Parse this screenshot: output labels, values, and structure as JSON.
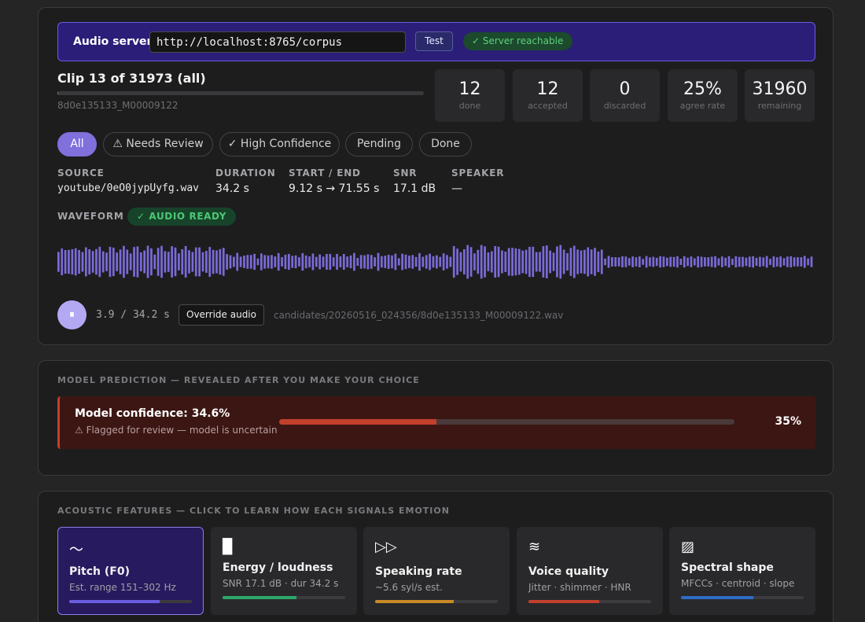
{
  "server": {
    "label": "Audio server:",
    "url": "http://localhost:8765/corpus",
    "test_label": "Test",
    "status": "✓ Server reachable"
  },
  "clip": {
    "title": "Clip 13 of 31973 (all)",
    "progress_fraction": 0.0004,
    "id": "8d0e135133_M00009122"
  },
  "stats": [
    {
      "value": "12",
      "label": "done"
    },
    {
      "value": "12",
      "label": "accepted"
    },
    {
      "value": "0",
      "label": "discarded"
    },
    {
      "value": "25%",
      "label": "agree rate"
    },
    {
      "value": "31960",
      "label": "remaining"
    }
  ],
  "filters": [
    {
      "label": "All",
      "active": true
    },
    {
      "label": "⚠ Needs Review",
      "active": false
    },
    {
      "label": "✓ High Confidence",
      "active": false
    },
    {
      "label": "Pending",
      "active": false
    },
    {
      "label": "Done",
      "active": false
    }
  ],
  "meta": {
    "source_h": "SOURCE",
    "source_v": "youtube/0eO0jypUyfg.wav",
    "duration_h": "DURATION",
    "duration_v": "34.2 s",
    "startend_h": "START / END",
    "startend_v": "9.12 s → 71.55 s",
    "snr_h": "SNR",
    "snr_v": "17.1 dB",
    "speaker_h": "SPEAKER",
    "speaker_v": "—"
  },
  "waveform": {
    "label": "WAVEFORM",
    "status": "✓ AUDIO READY",
    "color": "#7b6bd8"
  },
  "player": {
    "play_icon": "pause-icon",
    "play_glyph": "⏸",
    "time": "3.9 / 34.2 s",
    "override_label": "Override audio",
    "file_path": "candidates/20260516_024356/8d0e135133_M00009122.wav"
  },
  "prediction": {
    "heading": "MODEL PREDICTION — REVEALED AFTER YOU MAKE YOUR CHOICE",
    "title": "Model confidence: 34.6%",
    "subtitle": "⚠ Flagged for review — model is uncertain",
    "fraction": 0.346,
    "percent": "35%",
    "color": "#c2402c"
  },
  "features": {
    "heading": "ACOUSTIC FEATURES — CLICK TO LEARN HOW EACH SIGNALS EMOTION",
    "items": [
      {
        "icon": "〜",
        "icon_name": "wave-icon",
        "name": "Pitch (F0)",
        "desc": "Est. range 151–302 Hz",
        "fill": 0.74,
        "color": "#6b5ce0",
        "active": true
      },
      {
        "icon": "▉",
        "icon_name": "bar-icon",
        "name": "Energy / loudness",
        "desc": "SNR 17.1 dB · dur 34.2 s",
        "fill": 0.6,
        "color": "#2ea86a",
        "active": false
      },
      {
        "icon": "▷▷",
        "icon_name": "fast-forward-icon",
        "name": "Speaking rate",
        "desc": "~5.6 syl/s est.",
        "fill": 0.64,
        "color": "#c88a26",
        "active": false
      },
      {
        "icon": "≋",
        "icon_name": "voice-wave-icon",
        "name": "Voice quality",
        "desc": "Jitter · shimmer · HNR",
        "fill": 0.58,
        "color": "#c2402c",
        "active": false
      },
      {
        "icon": "▨",
        "icon_name": "spectrum-icon",
        "name": "Spectral shape",
        "desc": "MFCCs · centroid · slope",
        "fill": 0.59,
        "color": "#2f6cc8",
        "active": false
      }
    ]
  }
}
